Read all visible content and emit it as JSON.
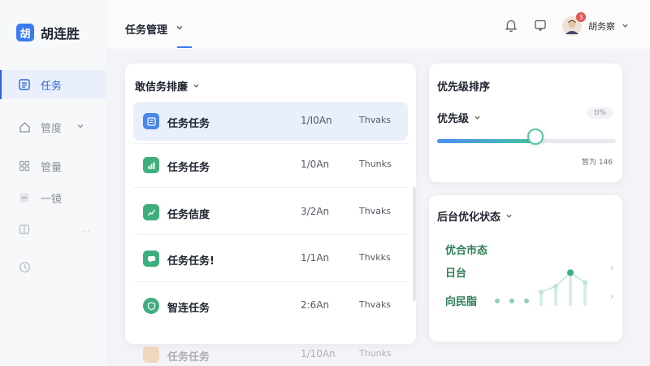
{
  "brand": {
    "logo_char": "胡",
    "name": "胡连胜"
  },
  "sidebar": {
    "items": [
      {
        "label": "任务",
        "icon": "list-icon",
        "active": true
      },
      {
        "label": "管度",
        "icon": "home-icon",
        "active": false
      },
      {
        "label": "管量",
        "icon": "grid-icon",
        "active": false
      },
      {
        "label": "一镜",
        "icon": "square-icon",
        "active": false
      },
      {
        "label": "",
        "icon": "book-icon",
        "active": false
      },
      {
        "label": "",
        "icon": "clock-icon",
        "active": false
      }
    ]
  },
  "topbar": {
    "tab_label": "任务管理",
    "user_name": "胡务察",
    "badge_count": "3"
  },
  "task_list": {
    "title": "敢佶务排廉",
    "rows": [
      {
        "name": "任务任务",
        "count": "1/I0An",
        "status": "Thvaks",
        "icon": "doc-icon",
        "color": "#4a86ec"
      },
      {
        "name": "任务任务",
        "count": "1/0An",
        "status": "Thunks",
        "icon": "bar-chart-icon",
        "color": "#3fae7f"
      },
      {
        "name": "任务佶度",
        "count": "3/2An",
        "status": "Thvaks",
        "icon": "line-chart-icon",
        "color": "#3fae7f"
      },
      {
        "name": "任务任务!",
        "count": "1/1An",
        "status": "Thvkks",
        "icon": "chat-icon",
        "color": "#3fae7f"
      },
      {
        "name": "智连任务",
        "count": "2:6An",
        "status": "Thvaks",
        "icon": "shield-icon",
        "color": "#3fae7f"
      }
    ],
    "faded_row": {
      "name": "任务任务",
      "count": "1/10An",
      "status": "Thunks"
    }
  },
  "priority": {
    "title": "优先级排序",
    "dropdown_label": "优先级",
    "pill": "tI%",
    "caption": "暂为 146",
    "value": 0.55,
    "accent_start": "#4d8ef0",
    "accent_end": "#46c2a0"
  },
  "status": {
    "title": "后台优化状态",
    "items": [
      "优合市态",
      "日台",
      "向民脂"
    ],
    "sparkline": [
      0.15,
      0.2,
      0.25,
      0.35,
      0.5,
      0.85,
      0.6
    ]
  }
}
